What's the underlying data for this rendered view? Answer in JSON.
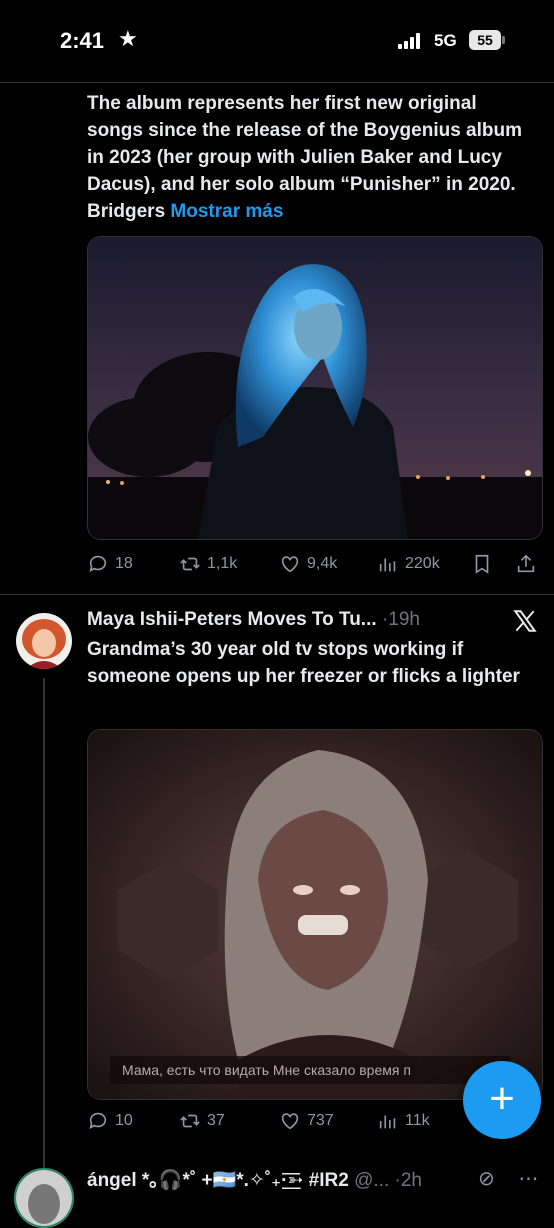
{
  "status_bar": {
    "time": "2:41",
    "network": "5G",
    "battery": "55"
  },
  "tweet1": {
    "text": "The album represents her first new original songs since the release of  the Boygenius album in 2023 (her group with Julien Baker and Lucy  Dacus), and her solo album “Punisher” in 2020. Bridgers",
    "more": "Mostrar más",
    "stats": {
      "replies": "18",
      "reposts": "1,1k",
      "likes": "9,4k",
      "views": "220k"
    }
  },
  "tweet2": {
    "author": "Maya Ishii-Peters Moves To Tu...",
    "separator": "·",
    "time": "19h",
    "text": "Grandma’s 30 year old tv stops working if someone opens up her freezer or flicks a lighter",
    "caption": "Мама, есть что видать Мне сказало время п",
    "stats": {
      "replies": "10",
      "reposts": "37",
      "likes": "737",
      "views": "11k"
    }
  },
  "tweet3": {
    "author": "ángel *｡🎧*˚ +🇦🇷*.✧˚₊·͟͟͞͞➳ #IR2",
    "handle": "@...",
    "separator": "·",
    "time": "2h"
  },
  "colors": {
    "accent": "#1d9bf0",
    "muted": "#8b98a5",
    "background": "#000000"
  }
}
